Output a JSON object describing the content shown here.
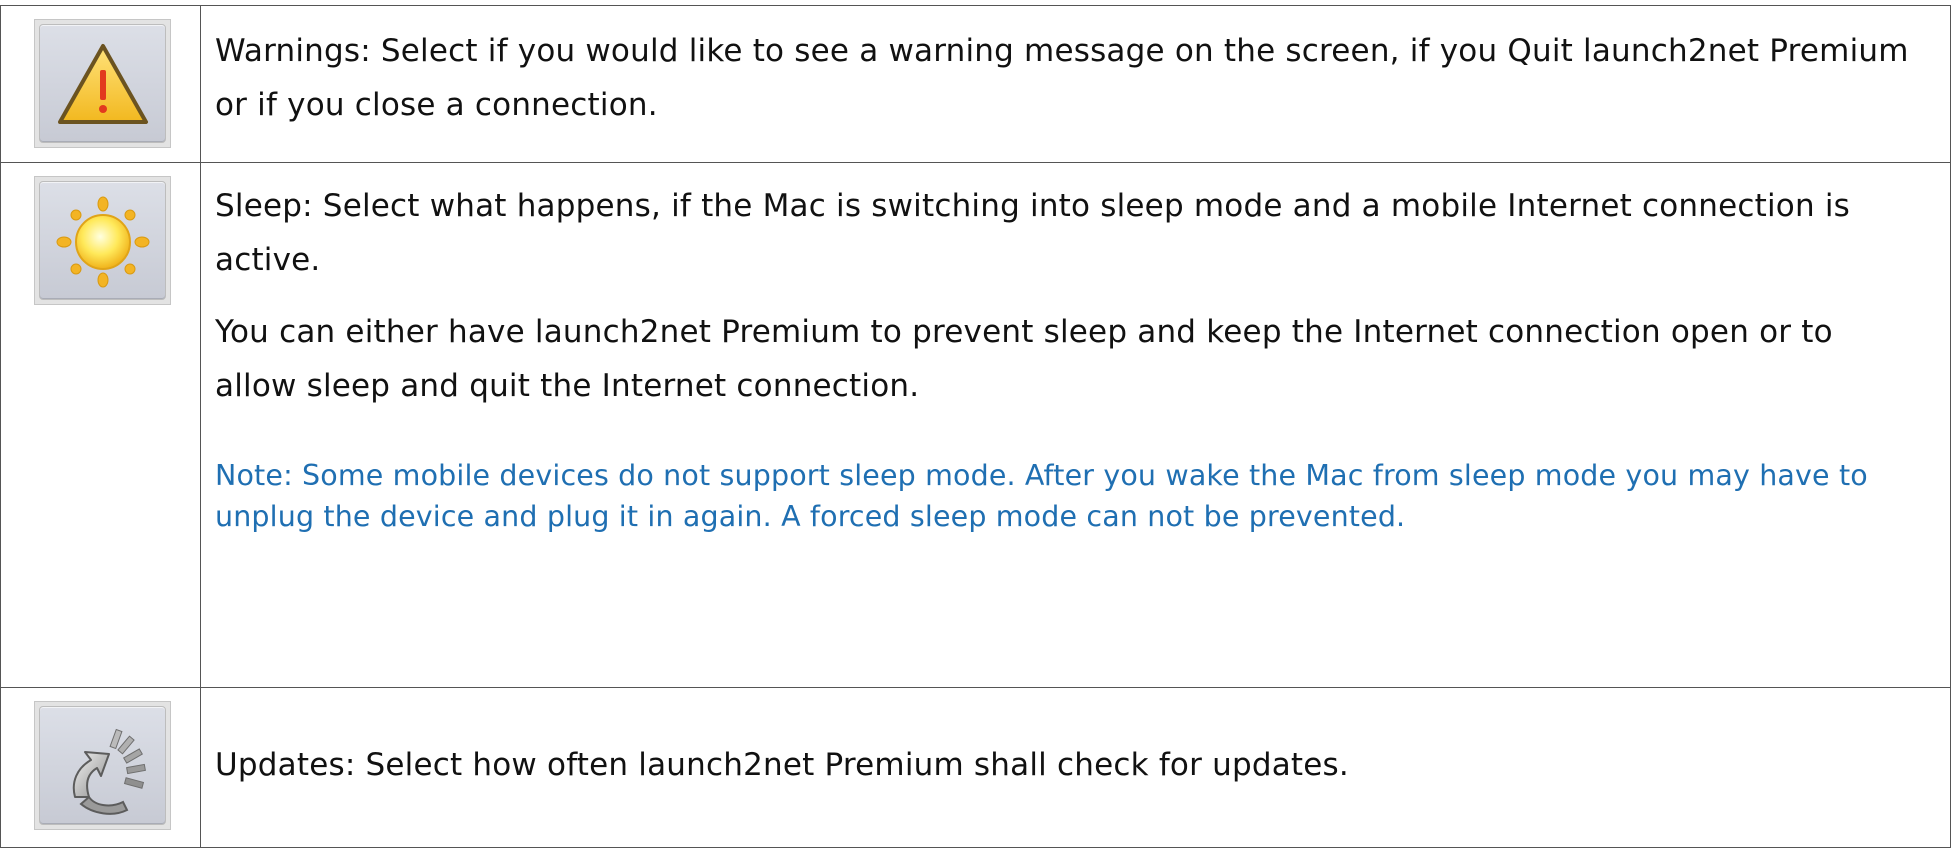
{
  "rows": [
    {
      "icon": "warning-triangle-icon",
      "text": "Warnings: Select if you would like to see a warning message on the screen, if you Quit launch2net Premium or if you close a connection."
    },
    {
      "icon": "sun-icon",
      "text": "Sleep: Select what happens, if the Mac is switching into sleep mode and a mobile Internet connection is active.",
      "text2": "You can either have launch2net Premium to prevent sleep and keep the Internet connection open or to allow sleep and quit the Internet connection.",
      "note": "Note: Some mobile devices do not support sleep mode. After you wake the Mac from sleep mode you may have to unplug the device and plug it in again. A forced sleep mode can not be prevented."
    },
    {
      "icon": "update-arrows-icon",
      "text": "Updates: Select how often launch2net Premium shall check for updates."
    }
  ],
  "colors": {
    "note": "#1f6fb2",
    "border": "#555555"
  }
}
